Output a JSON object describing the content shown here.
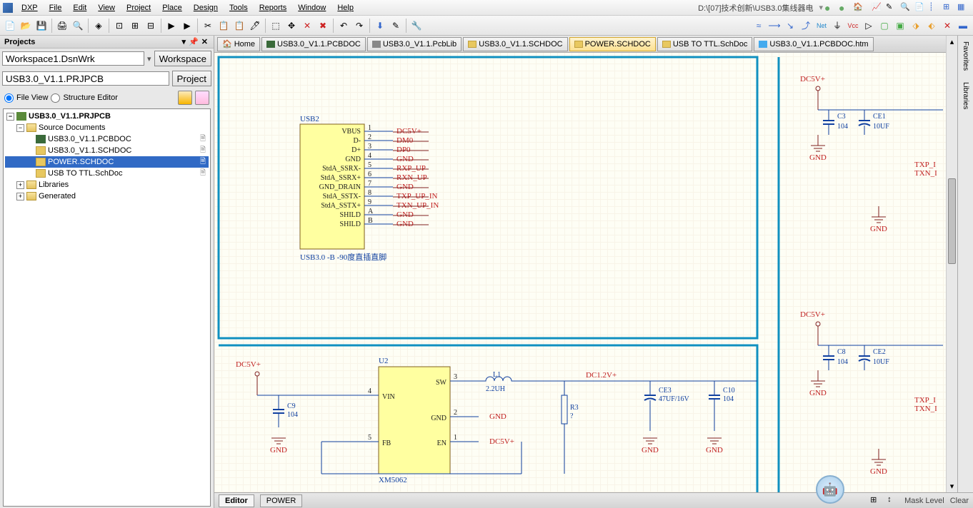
{
  "menu": {
    "dxp": "DXP",
    "file": "File",
    "edit": "Edit",
    "view": "View",
    "project": "Project",
    "place": "Place",
    "design": "Design",
    "tools": "Tools",
    "reports": "Reports",
    "window": "Window",
    "help": "Help"
  },
  "filepath": "D:\\[07]技术创新\\USB3.0集线器电",
  "projects_panel": {
    "title": "Projects",
    "workspace_value": "Workspace1.DsnWrk",
    "workspace_btn": "Workspace",
    "project_value": "USB3.0_V1.1.PRJPCB",
    "project_btn": "Project",
    "fileview": "File View",
    "structeditor": "Structure Editor"
  },
  "tree": {
    "root": "USB3.0_V1.1.PRJPCB",
    "src": "Source Documents",
    "docs": [
      {
        "name": "USB3.0_V1.1.PCBDOC",
        "icon": "pcb"
      },
      {
        "name": "USB3.0_V1.1.SCHDOC",
        "icon": "sch"
      },
      {
        "name": "POWER.SCHDOC",
        "icon": "sch",
        "selected": true
      },
      {
        "name": "USB TO TTL.SchDoc",
        "icon": "sch"
      }
    ],
    "libs": "Libraries",
    "gen": "Generated"
  },
  "doctabs": {
    "home": "Home",
    "tabs": [
      {
        "label": "USB3.0_V1.1.PCBDOC",
        "icon": "pcb"
      },
      {
        "label": "USB3.0_V1.1.PcbLib",
        "icon": "pcblib"
      },
      {
        "label": "USB3.0_V1.1.SCHDOC",
        "icon": "sch"
      },
      {
        "label": "POWER.SCHDOC",
        "icon": "sch",
        "active": true
      },
      {
        "label": "USB TO TTL.SchDoc",
        "icon": "sch"
      },
      {
        "label": "USB3.0_V1.1.PCBDOC.htm",
        "icon": "htm"
      }
    ]
  },
  "bottombar": {
    "editor": "Editor",
    "power": "POWER",
    "mask": "Mask Level",
    "clear": "Clear"
  },
  "rightpanels": {
    "fav": "Favorites",
    "lib": "Libraries"
  },
  "schematic": {
    "usb2": {
      "desig": "USB2",
      "comment": "USB3.0 -B -90度直插直脚",
      "pins": [
        {
          "no": "1",
          "name": "VBUS",
          "net": "DC5V+"
        },
        {
          "no": "2",
          "name": "D-",
          "net": "DM0"
        },
        {
          "no": "3",
          "name": "D+",
          "net": "DP0"
        },
        {
          "no": "4",
          "name": "GND",
          "net": "GND"
        },
        {
          "no": "5",
          "name": "StdA_SSRX-",
          "net": "RXP_UP"
        },
        {
          "no": "6",
          "name": "StdA_SSRX+",
          "net": "RXN_UP"
        },
        {
          "no": "7",
          "name": "GND_DRAIN",
          "net": "GND"
        },
        {
          "no": "8",
          "name": "StdA_SSTX-",
          "net": "TXP_UP_IN"
        },
        {
          "no": "9",
          "name": "StdA_SSTX+",
          "net": "TXN_UP_IN"
        },
        {
          "no": "A",
          "name": "SHILD",
          "net": "GND"
        },
        {
          "no": "B",
          "name": "SHILD",
          "net": "GND"
        }
      ]
    },
    "u2": {
      "desig": "U2",
      "comment": "XM5062",
      "pins": {
        "vin": "VIN",
        "sw": "SW",
        "gnd": "GND",
        "fb": "FB",
        "en": "EN"
      },
      "nos": {
        "vin": "4",
        "sw": "3",
        "gnd": "2",
        "fb": "5",
        "en": "1"
      }
    },
    "nets": {
      "dc5v": "DC5V+",
      "dc1v2": "DC1.2V+",
      "gnd": "GND",
      "txp": "TXP_I",
      "txn": "TXN_I"
    },
    "l1": {
      "desig": "L1",
      "value": "2.2UH"
    },
    "c9": {
      "desig": "C9",
      "value": "104"
    },
    "ce3": {
      "desig": "CE3",
      "value": "47UF/16V"
    },
    "c10": {
      "desig": "C10",
      "value": "104"
    },
    "r3": {
      "desig": "R3",
      "value": "?"
    },
    "c3": {
      "desig": "C3",
      "value": "104"
    },
    "ce1": {
      "desig": "CE1",
      "value": "10UF"
    },
    "c8": {
      "desig": "C8",
      "value": "104"
    },
    "ce2": {
      "desig": "CE2",
      "value": "10UF"
    }
  }
}
